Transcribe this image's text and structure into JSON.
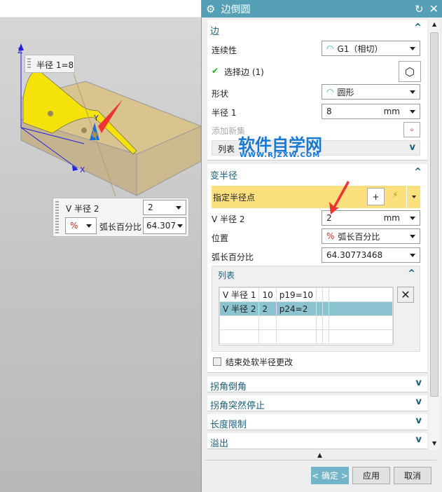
{
  "viewport": {
    "axis_z": "Z",
    "axis_y": "Y",
    "axis_x": "X",
    "radius_tag": "半径 1=8",
    "vr_popup": {
      "label": "V 半径 2",
      "value": "2",
      "pos_icon": "%",
      "arc_label": "弧长百分比",
      "arc_value": "64.307"
    }
  },
  "dialog": {
    "title": "边倒圆",
    "edge": {
      "title": "边",
      "continuity_label": "连续性",
      "continuity_value": "G1（相切）",
      "select_edge": "选择边 (1)",
      "shape_label": "形状",
      "shape_value": "圆形",
      "radius_label": "半径 1",
      "radius_value": "8",
      "radius_unit": "mm",
      "add_set": "添加新集",
      "list": "列表"
    },
    "variable": {
      "title": "变半径",
      "specify_point": "指定半径点",
      "vr_label": "V 半径 2",
      "vr_value": "2",
      "vr_unit": "mm",
      "position_label": "位置",
      "position_value": "弧长百分比",
      "arc_label": "弧长百分比",
      "arc_value": "64.30773468",
      "list_title": "列表",
      "rows": [
        [
          "V 半径 1",
          "10",
          "p19=10"
        ],
        [
          "V 半径 2",
          "2",
          "p24=2"
        ]
      ],
      "checkbox": "结束处软半径更改"
    },
    "collapsed": [
      "拐角倒角",
      "拐角突然停止",
      "长度限制",
      "溢出"
    ],
    "ok": "< 确定 >",
    "apply": "应用",
    "cancel": "取消"
  },
  "watermark": {
    "cn": "软件自学网",
    "url": "WWW.RJZXW.COM"
  },
  "colors": {
    "titlebar": "#56a0b7",
    "highlight": "#fde07e",
    "selected_row": "#8cc3d1"
  }
}
